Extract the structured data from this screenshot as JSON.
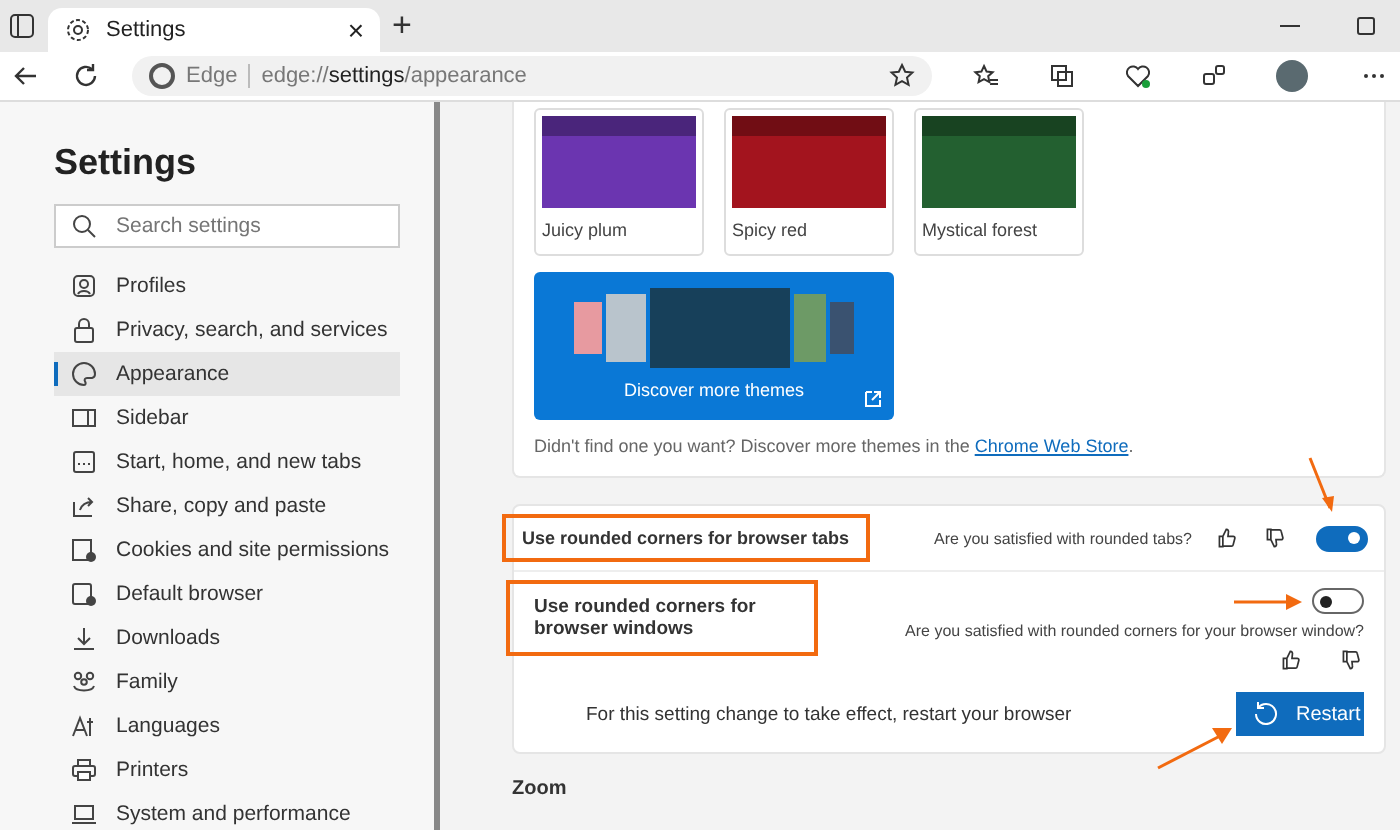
{
  "tab": {
    "title": "Settings",
    "close": "×"
  },
  "new_tab": "+",
  "address_bar": {
    "site_label": "Edge",
    "url_prefix": "edge://",
    "url_bold": "settings",
    "url_suffix": "/appearance"
  },
  "sidebar": {
    "title": "Settings",
    "search": {
      "placeholder": "Search settings"
    },
    "items": [
      {
        "label": "Profiles",
        "kind": "profile",
        "selected": false
      },
      {
        "label": "Privacy, search, and services",
        "kind": "lock",
        "selected": false
      },
      {
        "label": "Appearance",
        "kind": "palette",
        "selected": true
      },
      {
        "label": "Sidebar",
        "kind": "sidebar",
        "selected": false
      },
      {
        "label": "Start, home, and new tabs",
        "kind": "home",
        "selected": false
      },
      {
        "label": "Share, copy and paste",
        "kind": "share",
        "selected": false
      },
      {
        "label": "Cookies and site permissions",
        "kind": "cookie",
        "selected": false
      },
      {
        "label": "Default browser",
        "kind": "browser",
        "selected": false
      },
      {
        "label": "Downloads",
        "kind": "download",
        "selected": false
      },
      {
        "label": "Family",
        "kind": "family",
        "selected": false
      },
      {
        "label": "Languages",
        "kind": "language",
        "selected": false
      },
      {
        "label": "Printers",
        "kind": "printer",
        "selected": false
      },
      {
        "label": "System and performance",
        "kind": "laptop",
        "selected": false
      }
    ]
  },
  "themes": [
    {
      "name": "Juicy plum",
      "color": "#6b35b0"
    },
    {
      "name": "Spicy red",
      "color": "#a3141e"
    },
    {
      "name": "Mystical forest",
      "color": "#236030"
    }
  ],
  "discover_tile": {
    "label": "Discover more themes"
  },
  "themes_note": {
    "text": "Didn't find one you want? Discover more themes in the ",
    "link": "Chrome Web Store",
    "end": "."
  },
  "settings": [
    {
      "label": "Use rounded corners for browser tabs",
      "question": "Are you satisfied with rounded tabs?",
      "on": true,
      "highlighted": true
    },
    {
      "label": "Use rounded corners for browser windows",
      "question": "Are you satisfied with rounded corners for your browser window?",
      "on": false,
      "highlighted": true
    }
  ],
  "restart": {
    "message": "For this setting change to take effect, restart your browser",
    "button": "Restart"
  },
  "next_section": "Zoom"
}
